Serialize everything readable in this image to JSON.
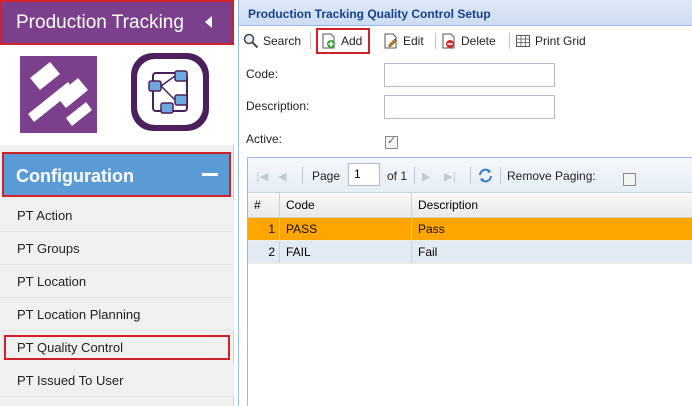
{
  "sidebar": {
    "header_title": "Production Tracking",
    "config_title": "Configuration",
    "items": [
      {
        "label": "PT Action"
      },
      {
        "label": "PT Groups"
      },
      {
        "label": "PT Location"
      },
      {
        "label": "PT Location Planning"
      },
      {
        "label": "PT Quality Control"
      },
      {
        "label": "PT Issued To User"
      }
    ],
    "selected_item": "PT Quality Control"
  },
  "panel": {
    "title": "Production Tracking Quality Control Setup"
  },
  "toolbar": {
    "search_label": "Search",
    "add_label": "Add",
    "edit_label": "Edit",
    "delete_label": "Delete",
    "print_label": "Print Grid"
  },
  "form": {
    "code_label": "Code:",
    "code_value": "",
    "description_label": "Description:",
    "description_value": "",
    "active_label": "Active:",
    "active_checked": true
  },
  "pager": {
    "page_label": "Page",
    "page_value": "1",
    "of_label": "of 1",
    "remove_paging_label": "Remove Paging:",
    "remove_paging_checked": false
  },
  "grid": {
    "columns": {
      "num": "#",
      "code": "Code",
      "description": "Description"
    },
    "rows": [
      {
        "num": "1",
        "code": "PASS",
        "description": "Pass",
        "selected": true
      },
      {
        "num": "2",
        "code": "FAIL",
        "description": "Fail",
        "selected": false
      }
    ]
  },
  "colors": {
    "brand_purple": "#7b3f8c",
    "config_blue": "#5b9bd5",
    "highlight_red": "#d0202a",
    "selected_row": "#ffa500"
  }
}
